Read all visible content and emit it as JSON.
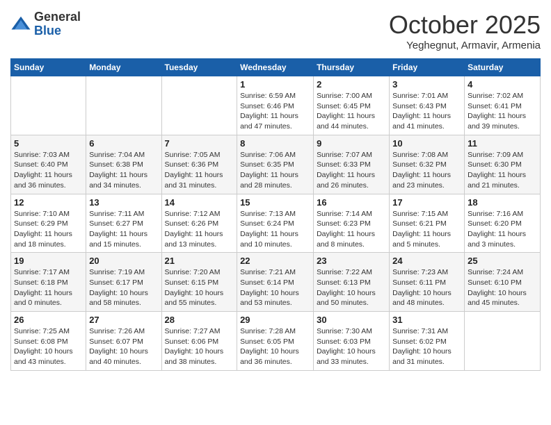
{
  "logo": {
    "general": "General",
    "blue": "Blue"
  },
  "title": "October 2025",
  "location": "Yeghegnut, Armavir, Armenia",
  "weekdays": [
    "Sunday",
    "Monday",
    "Tuesday",
    "Wednesday",
    "Thursday",
    "Friday",
    "Saturday"
  ],
  "weeks": [
    [
      {
        "day": "",
        "info": ""
      },
      {
        "day": "",
        "info": ""
      },
      {
        "day": "",
        "info": ""
      },
      {
        "day": "1",
        "info": "Sunrise: 6:59 AM\nSunset: 6:46 PM\nDaylight: 11 hours\nand 47 minutes."
      },
      {
        "day": "2",
        "info": "Sunrise: 7:00 AM\nSunset: 6:45 PM\nDaylight: 11 hours\nand 44 minutes."
      },
      {
        "day": "3",
        "info": "Sunrise: 7:01 AM\nSunset: 6:43 PM\nDaylight: 11 hours\nand 41 minutes."
      },
      {
        "day": "4",
        "info": "Sunrise: 7:02 AM\nSunset: 6:41 PM\nDaylight: 11 hours\nand 39 minutes."
      }
    ],
    [
      {
        "day": "5",
        "info": "Sunrise: 7:03 AM\nSunset: 6:40 PM\nDaylight: 11 hours\nand 36 minutes."
      },
      {
        "day": "6",
        "info": "Sunrise: 7:04 AM\nSunset: 6:38 PM\nDaylight: 11 hours\nand 34 minutes."
      },
      {
        "day": "7",
        "info": "Sunrise: 7:05 AM\nSunset: 6:36 PM\nDaylight: 11 hours\nand 31 minutes."
      },
      {
        "day": "8",
        "info": "Sunrise: 7:06 AM\nSunset: 6:35 PM\nDaylight: 11 hours\nand 28 minutes."
      },
      {
        "day": "9",
        "info": "Sunrise: 7:07 AM\nSunset: 6:33 PM\nDaylight: 11 hours\nand 26 minutes."
      },
      {
        "day": "10",
        "info": "Sunrise: 7:08 AM\nSunset: 6:32 PM\nDaylight: 11 hours\nand 23 minutes."
      },
      {
        "day": "11",
        "info": "Sunrise: 7:09 AM\nSunset: 6:30 PM\nDaylight: 11 hours\nand 21 minutes."
      }
    ],
    [
      {
        "day": "12",
        "info": "Sunrise: 7:10 AM\nSunset: 6:29 PM\nDaylight: 11 hours\nand 18 minutes."
      },
      {
        "day": "13",
        "info": "Sunrise: 7:11 AM\nSunset: 6:27 PM\nDaylight: 11 hours\nand 15 minutes."
      },
      {
        "day": "14",
        "info": "Sunrise: 7:12 AM\nSunset: 6:26 PM\nDaylight: 11 hours\nand 13 minutes."
      },
      {
        "day": "15",
        "info": "Sunrise: 7:13 AM\nSunset: 6:24 PM\nDaylight: 11 hours\nand 10 minutes."
      },
      {
        "day": "16",
        "info": "Sunrise: 7:14 AM\nSunset: 6:23 PM\nDaylight: 11 hours\nand 8 minutes."
      },
      {
        "day": "17",
        "info": "Sunrise: 7:15 AM\nSunset: 6:21 PM\nDaylight: 11 hours\nand 5 minutes."
      },
      {
        "day": "18",
        "info": "Sunrise: 7:16 AM\nSunset: 6:20 PM\nDaylight: 11 hours\nand 3 minutes."
      }
    ],
    [
      {
        "day": "19",
        "info": "Sunrise: 7:17 AM\nSunset: 6:18 PM\nDaylight: 11 hours\nand 0 minutes."
      },
      {
        "day": "20",
        "info": "Sunrise: 7:19 AM\nSunset: 6:17 PM\nDaylight: 10 hours\nand 58 minutes."
      },
      {
        "day": "21",
        "info": "Sunrise: 7:20 AM\nSunset: 6:15 PM\nDaylight: 10 hours\nand 55 minutes."
      },
      {
        "day": "22",
        "info": "Sunrise: 7:21 AM\nSunset: 6:14 PM\nDaylight: 10 hours\nand 53 minutes."
      },
      {
        "day": "23",
        "info": "Sunrise: 7:22 AM\nSunset: 6:13 PM\nDaylight: 10 hours\nand 50 minutes."
      },
      {
        "day": "24",
        "info": "Sunrise: 7:23 AM\nSunset: 6:11 PM\nDaylight: 10 hours\nand 48 minutes."
      },
      {
        "day": "25",
        "info": "Sunrise: 7:24 AM\nSunset: 6:10 PM\nDaylight: 10 hours\nand 45 minutes."
      }
    ],
    [
      {
        "day": "26",
        "info": "Sunrise: 7:25 AM\nSunset: 6:08 PM\nDaylight: 10 hours\nand 43 minutes."
      },
      {
        "day": "27",
        "info": "Sunrise: 7:26 AM\nSunset: 6:07 PM\nDaylight: 10 hours\nand 40 minutes."
      },
      {
        "day": "28",
        "info": "Sunrise: 7:27 AM\nSunset: 6:06 PM\nDaylight: 10 hours\nand 38 minutes."
      },
      {
        "day": "29",
        "info": "Sunrise: 7:28 AM\nSunset: 6:05 PM\nDaylight: 10 hours\nand 36 minutes."
      },
      {
        "day": "30",
        "info": "Sunrise: 7:30 AM\nSunset: 6:03 PM\nDaylight: 10 hours\nand 33 minutes."
      },
      {
        "day": "31",
        "info": "Sunrise: 7:31 AM\nSunset: 6:02 PM\nDaylight: 10 hours\nand 31 minutes."
      },
      {
        "day": "",
        "info": ""
      }
    ]
  ]
}
